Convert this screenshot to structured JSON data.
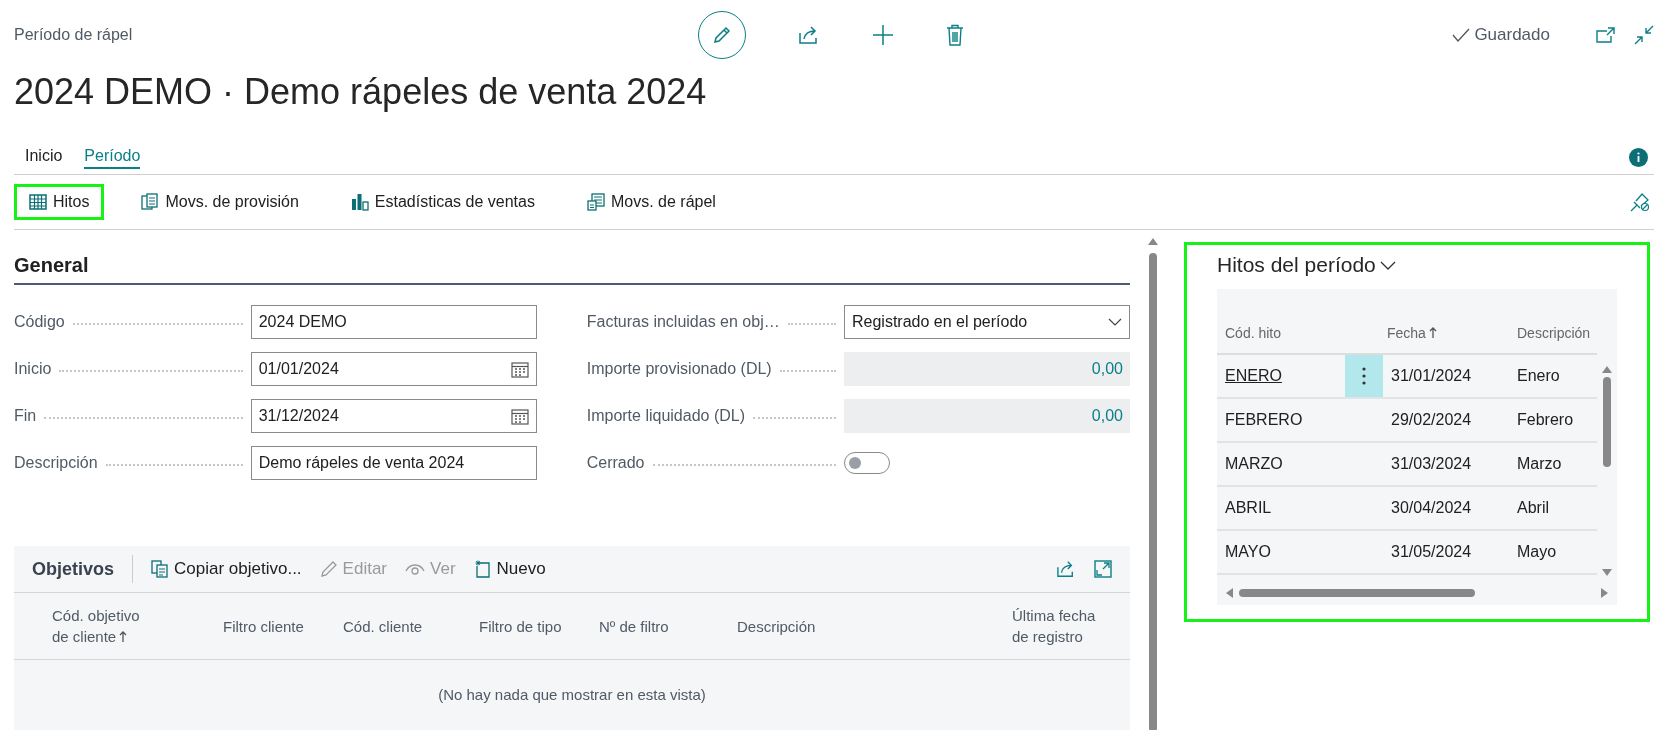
{
  "header": {
    "breadcrumb": "Período de rápel",
    "title": "2024 DEMO · Demo rápeles de venta 2024",
    "status": "Guardado"
  },
  "tabs": [
    {
      "label": "Inicio",
      "selected": false
    },
    {
      "label": "Período",
      "selected": true
    }
  ],
  "actions": [
    {
      "label": "Hitos",
      "kind": "grid",
      "highlighted": true
    },
    {
      "label": "Movs. de provisión",
      "kind": "ledger",
      "highlighted": false
    },
    {
      "label": "Estadísticas de ventas",
      "kind": "chart",
      "highlighted": false
    },
    {
      "label": "Movs. de rápel",
      "kind": "register",
      "highlighted": false
    }
  ],
  "general": {
    "heading": "General",
    "fields_left": [
      {
        "label": "Código",
        "kind": "text",
        "value": "2024 DEMO"
      },
      {
        "label": "Inicio",
        "kind": "date",
        "value": "01/01/2024"
      },
      {
        "label": "Fin",
        "kind": "date",
        "value": "31/12/2024"
      },
      {
        "label": "Descripción",
        "kind": "text",
        "value": "Demo rápeles de venta 2024"
      }
    ],
    "fields_right": [
      {
        "label": "Facturas incluidas en obj…",
        "kind": "select",
        "value": "Registrado en el período"
      },
      {
        "label": "Importe provisionado (DL)",
        "kind": "readonly",
        "value": "0,00"
      },
      {
        "label": "Importe liquidado (DL)",
        "kind": "readonly",
        "value": "0,00"
      },
      {
        "label": "Cerrado",
        "kind": "toggle",
        "on": false
      }
    ]
  },
  "objetivos": {
    "title": "Objetivos",
    "actions": [
      {
        "label": "Copiar objetivo...",
        "kind": "copy",
        "disabled": false
      },
      {
        "label": "Editar",
        "kind": "pencil",
        "disabled": true
      },
      {
        "label": "Ver",
        "kind": "eye",
        "disabled": true
      },
      {
        "label": "Nuevo",
        "kind": "new",
        "disabled": false
      }
    ],
    "columns": [
      {
        "label": "Cód. objetivo de cliente",
        "sorted": true
      },
      {
        "label": "Filtro cliente",
        "sorted": false
      },
      {
        "label": "Cód. cliente",
        "sorted": false
      },
      {
        "label": "Filtro de tipo",
        "sorted": false
      },
      {
        "label": "Nº de filtro",
        "sorted": false
      },
      {
        "label": "Descripción",
        "sorted": false
      },
      {
        "label": "Última fecha de registro",
        "sorted": false
      }
    ],
    "empty": "(No hay nada que mostrar en esta vista)"
  },
  "hitos": {
    "title": "Hitos del período",
    "highlighted": true,
    "columns": [
      {
        "label": "Cód. hito",
        "sorted": false
      },
      {
        "label": "Fecha",
        "sorted": true
      },
      {
        "label": "Descripción",
        "sorted": false
      }
    ],
    "rows": [
      {
        "code": "ENERO",
        "date": "31/01/2024",
        "description": "Enero",
        "selected": true
      },
      {
        "code": "FEBRERO",
        "date": "29/02/2024",
        "description": "Febrero",
        "selected": false
      },
      {
        "code": "MARZO",
        "date": "31/03/2024",
        "description": "Marzo",
        "selected": false
      },
      {
        "code": "ABRIL",
        "date": "30/04/2024",
        "description": "Abril",
        "selected": false
      },
      {
        "code": "MAYO",
        "date": "31/05/2024",
        "description": "Mayo",
        "selected": false
      }
    ]
  }
}
